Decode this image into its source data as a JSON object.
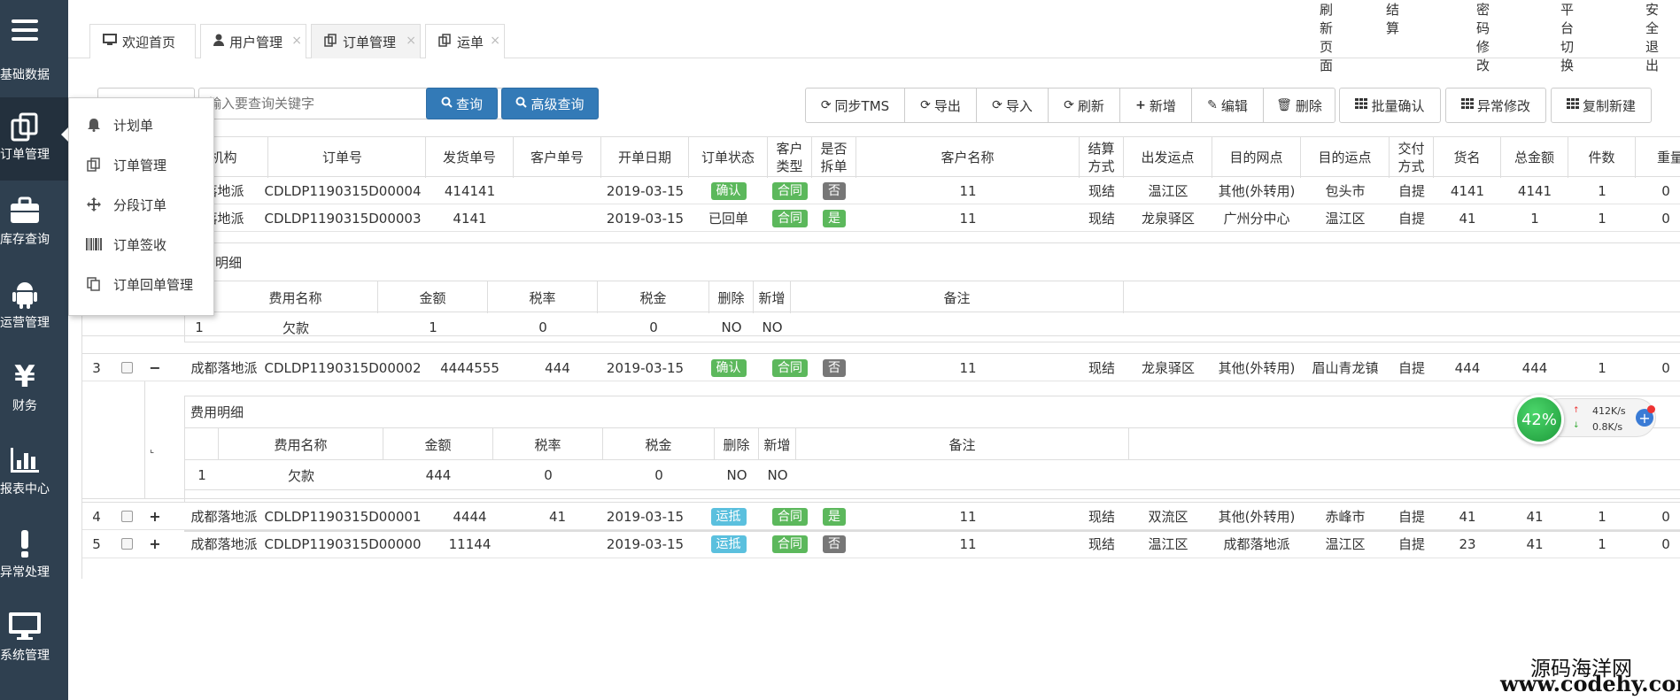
{
  "sidebar": {
    "items": [
      {
        "label": "基础数据",
        "icon": "menu-icon"
      },
      {
        "label": "订单管理",
        "icon": "copy-icon"
      },
      {
        "label": "库存查询",
        "icon": "briefcase-icon"
      },
      {
        "label": "运营管理",
        "icon": "android-icon"
      },
      {
        "label": "财务",
        "icon": "yen-icon"
      },
      {
        "label": "报表中心",
        "icon": "bar-chart-icon"
      },
      {
        "label": "异常处理",
        "icon": "exclamation-icon"
      },
      {
        "label": "系统管理",
        "icon": "monitor-icon"
      }
    ]
  },
  "header": {
    "links": [
      "刷新页面",
      "结算",
      "密码修改",
      "平台切换",
      "安全退出"
    ],
    "tabs": [
      {
        "label": "欢迎首页",
        "icon": "desktop-icon",
        "closable": false
      },
      {
        "label": "用户管理",
        "icon": "user-icon",
        "closable": true
      },
      {
        "label": "订单管理",
        "icon": "copy-icon",
        "closable": true,
        "active": true
      },
      {
        "label": "运单",
        "icon": "copy-icon",
        "closable": true
      }
    ]
  },
  "dropdown_menu": {
    "items": [
      {
        "label": "计划单",
        "icon": "bell-icon"
      },
      {
        "label": "订单管理",
        "icon": "copy-icon"
      },
      {
        "label": "分段订单",
        "icon": "move-icon"
      },
      {
        "label": "订单签收",
        "icon": "barcode-icon"
      },
      {
        "label": "订单回单管理",
        "icon": "files-icon"
      }
    ]
  },
  "toolbar": {
    "search_placeholder": "输入要查询关键字",
    "query_label": "查询",
    "advanced_label": "高级查询",
    "group1": [
      "同步TMS",
      "导出",
      "导入",
      "刷新",
      "新增",
      "编辑",
      "删除"
    ],
    "batch_confirm": "批量确认",
    "exception_edit": "异常修改",
    "copy_new": "复制新建"
  },
  "table": {
    "headers": [
      "机构",
      "订单号",
      "发货单号",
      "客户单号",
      "开单日期",
      "订单状态",
      "客户类型",
      "是否拆单",
      "客户名称",
      "结算方式",
      "出发运点",
      "目的网点",
      "目的运点",
      "交付方式",
      "货名",
      "总金额",
      "件数",
      "重量"
    ],
    "rows": [
      {
        "index": "",
        "expand": "",
        "org": "落地派",
        "order_no": "CDLDP1190315D00004",
        "ship_no": "414141",
        "cust_no": "",
        "date": "2019-03-15",
        "status": "确认",
        "status_style": "green",
        "cust_type": "合同",
        "split": "否",
        "split_style": "gray",
        "cust_name": "11",
        "settle": "现结",
        "from": "温江区",
        "dest_site": "其他(外转用)",
        "dest_point": "包头市",
        "delivery": "自提",
        "goods": "4141",
        "amount": "4141",
        "pieces": "1",
        "weight": "0"
      },
      {
        "index": "",
        "expand": "",
        "org": "落地派",
        "order_no": "CDLDP1190315D00003",
        "ship_no": "4141",
        "cust_no": "",
        "date": "2019-03-15",
        "status": "已回单",
        "status_style": "text",
        "cust_type": "合同",
        "split": "是",
        "split_style": "green",
        "cust_name": "11",
        "settle": "现结",
        "from": "龙泉驿区",
        "dest_site": "广州分中心",
        "dest_point": "温江区",
        "delivery": "自提",
        "goods": "41",
        "amount": "1",
        "pieces": "1",
        "weight": "0"
      },
      {
        "index": "3",
        "expand": "−",
        "org": "成都落地派",
        "order_no": "CDLDP1190315D00002",
        "ship_no": "4444555",
        "cust_no": "444",
        "date": "2019-03-15",
        "status": "确认",
        "status_style": "green",
        "cust_type": "合同",
        "split": "否",
        "split_style": "gray",
        "cust_name": "11",
        "settle": "现结",
        "from": "龙泉驿区",
        "dest_site": "其他(外转用)",
        "dest_point": "眉山青龙镇",
        "delivery": "自提",
        "goods": "444",
        "amount": "444",
        "pieces": "1",
        "weight": "0"
      },
      {
        "index": "4",
        "expand": "+",
        "org": "成都落地派",
        "order_no": "CDLDP1190315D00001",
        "ship_no": "4444",
        "cust_no": "41",
        "date": "2019-03-15",
        "status": "运抵",
        "status_style": "cyan",
        "cust_type": "合同",
        "split": "是",
        "split_style": "green",
        "cust_name": "11",
        "settle": "现结",
        "from": "双流区",
        "dest_site": "其他(外转用)",
        "dest_point": "赤峰市",
        "delivery": "自提",
        "goods": "41",
        "amount": "41",
        "pieces": "1",
        "weight": "0"
      },
      {
        "index": "5",
        "expand": "+",
        "org": "成都落地派",
        "order_no": "CDLDP1190315D00000",
        "ship_no": "11144",
        "cust_no": "",
        "date": "2019-03-15",
        "status": "运抵",
        "status_style": "cyan",
        "cust_type": "合同",
        "split": "否",
        "split_style": "gray",
        "cust_name": "11",
        "settle": "现结",
        "from": "温江区",
        "dest_site": "成都落地派",
        "dest_point": "温江区",
        "delivery": "自提",
        "goods": "23",
        "amount": "41",
        "pieces": "1",
        "weight": "0"
      }
    ]
  },
  "fee_detail": {
    "title1": "明细",
    "title2": "费用明细",
    "headers": [
      "费用名称",
      "金额",
      "税率",
      "税金",
      "删除",
      "新增",
      "备注"
    ],
    "rows": [
      {
        "no": "1",
        "name": "欠款",
        "amount": "1",
        "rate": "0",
        "tax": "0",
        "del": "NO",
        "add": "NO"
      },
      {
        "no": "1",
        "name": "欠款",
        "amount": "444",
        "rate": "0",
        "tax": "0",
        "del": "NO",
        "add": "NO"
      }
    ]
  },
  "widget": {
    "percent": "42%",
    "up": "412K/s",
    "down": "0.8K/s"
  },
  "watermark": {
    "line1": "源码海洋网",
    "line2": "www.codehy.com"
  }
}
